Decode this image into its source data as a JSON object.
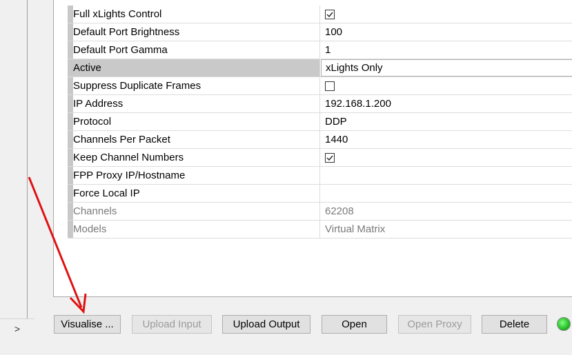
{
  "properties": [
    {
      "name": "Full xLights Control",
      "value": "",
      "checkbox": true,
      "checked": true
    },
    {
      "name": "Default Port Brightness",
      "value": "100"
    },
    {
      "name": "Default Port Gamma",
      "value": "1"
    },
    {
      "name": "Active",
      "value": "xLights Only",
      "selected": true
    },
    {
      "name": "Suppress Duplicate Frames",
      "value": "",
      "checkbox": true,
      "checked": false
    },
    {
      "name": "IP Address",
      "value": "192.168.1.200"
    },
    {
      "name": "Protocol",
      "value": "DDP"
    },
    {
      "name": "Channels Per Packet",
      "value": "1440"
    },
    {
      "name": "Keep Channel Numbers",
      "value": "",
      "checkbox": true,
      "checked": true
    },
    {
      "name": "FPP Proxy IP/Hostname",
      "value": ""
    },
    {
      "name": "Force Local IP",
      "value": ""
    },
    {
      "name": "Channels",
      "value": "62208",
      "disabled": true
    },
    {
      "name": "Models",
      "value": "Virtual Matrix",
      "disabled": true
    }
  ],
  "buttons": {
    "visualise": "Visualise ...",
    "upload_input": "Upload Input",
    "upload_output": "Upload Output",
    "open": "Open",
    "open_proxy": "Open Proxy",
    "delete": "Delete"
  },
  "expand_glyph": ">",
  "status": {
    "color": "#18b018"
  },
  "annotation_arrow_color": "#e01010"
}
